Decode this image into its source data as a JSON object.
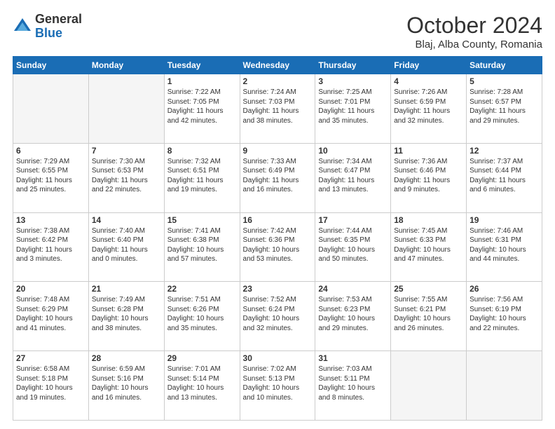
{
  "header": {
    "logo_general": "General",
    "logo_blue": "Blue",
    "month_title": "October 2024",
    "location": "Blaj, Alba County, Romania"
  },
  "weekdays": [
    "Sunday",
    "Monday",
    "Tuesday",
    "Wednesday",
    "Thursday",
    "Friday",
    "Saturday"
  ],
  "weeks": [
    [
      {
        "day": "",
        "info": ""
      },
      {
        "day": "",
        "info": ""
      },
      {
        "day": "1",
        "info": "Sunrise: 7:22 AM\nSunset: 7:05 PM\nDaylight: 11 hours and 42 minutes."
      },
      {
        "day": "2",
        "info": "Sunrise: 7:24 AM\nSunset: 7:03 PM\nDaylight: 11 hours and 38 minutes."
      },
      {
        "day": "3",
        "info": "Sunrise: 7:25 AM\nSunset: 7:01 PM\nDaylight: 11 hours and 35 minutes."
      },
      {
        "day": "4",
        "info": "Sunrise: 7:26 AM\nSunset: 6:59 PM\nDaylight: 11 hours and 32 minutes."
      },
      {
        "day": "5",
        "info": "Sunrise: 7:28 AM\nSunset: 6:57 PM\nDaylight: 11 hours and 29 minutes."
      }
    ],
    [
      {
        "day": "6",
        "info": "Sunrise: 7:29 AM\nSunset: 6:55 PM\nDaylight: 11 hours and 25 minutes."
      },
      {
        "day": "7",
        "info": "Sunrise: 7:30 AM\nSunset: 6:53 PM\nDaylight: 11 hours and 22 minutes."
      },
      {
        "day": "8",
        "info": "Sunrise: 7:32 AM\nSunset: 6:51 PM\nDaylight: 11 hours and 19 minutes."
      },
      {
        "day": "9",
        "info": "Sunrise: 7:33 AM\nSunset: 6:49 PM\nDaylight: 11 hours and 16 minutes."
      },
      {
        "day": "10",
        "info": "Sunrise: 7:34 AM\nSunset: 6:47 PM\nDaylight: 11 hours and 13 minutes."
      },
      {
        "day": "11",
        "info": "Sunrise: 7:36 AM\nSunset: 6:46 PM\nDaylight: 11 hours and 9 minutes."
      },
      {
        "day": "12",
        "info": "Sunrise: 7:37 AM\nSunset: 6:44 PM\nDaylight: 11 hours and 6 minutes."
      }
    ],
    [
      {
        "day": "13",
        "info": "Sunrise: 7:38 AM\nSunset: 6:42 PM\nDaylight: 11 hours and 3 minutes."
      },
      {
        "day": "14",
        "info": "Sunrise: 7:40 AM\nSunset: 6:40 PM\nDaylight: 11 hours and 0 minutes."
      },
      {
        "day": "15",
        "info": "Sunrise: 7:41 AM\nSunset: 6:38 PM\nDaylight: 10 hours and 57 minutes."
      },
      {
        "day": "16",
        "info": "Sunrise: 7:42 AM\nSunset: 6:36 PM\nDaylight: 10 hours and 53 minutes."
      },
      {
        "day": "17",
        "info": "Sunrise: 7:44 AM\nSunset: 6:35 PM\nDaylight: 10 hours and 50 minutes."
      },
      {
        "day": "18",
        "info": "Sunrise: 7:45 AM\nSunset: 6:33 PM\nDaylight: 10 hours and 47 minutes."
      },
      {
        "day": "19",
        "info": "Sunrise: 7:46 AM\nSunset: 6:31 PM\nDaylight: 10 hours and 44 minutes."
      }
    ],
    [
      {
        "day": "20",
        "info": "Sunrise: 7:48 AM\nSunset: 6:29 PM\nDaylight: 10 hours and 41 minutes."
      },
      {
        "day": "21",
        "info": "Sunrise: 7:49 AM\nSunset: 6:28 PM\nDaylight: 10 hours and 38 minutes."
      },
      {
        "day": "22",
        "info": "Sunrise: 7:51 AM\nSunset: 6:26 PM\nDaylight: 10 hours and 35 minutes."
      },
      {
        "day": "23",
        "info": "Sunrise: 7:52 AM\nSunset: 6:24 PM\nDaylight: 10 hours and 32 minutes."
      },
      {
        "day": "24",
        "info": "Sunrise: 7:53 AM\nSunset: 6:23 PM\nDaylight: 10 hours and 29 minutes."
      },
      {
        "day": "25",
        "info": "Sunrise: 7:55 AM\nSunset: 6:21 PM\nDaylight: 10 hours and 26 minutes."
      },
      {
        "day": "26",
        "info": "Sunrise: 7:56 AM\nSunset: 6:19 PM\nDaylight: 10 hours and 22 minutes."
      }
    ],
    [
      {
        "day": "27",
        "info": "Sunrise: 6:58 AM\nSunset: 5:18 PM\nDaylight: 10 hours and 19 minutes."
      },
      {
        "day": "28",
        "info": "Sunrise: 6:59 AM\nSunset: 5:16 PM\nDaylight: 10 hours and 16 minutes."
      },
      {
        "day": "29",
        "info": "Sunrise: 7:01 AM\nSunset: 5:14 PM\nDaylight: 10 hours and 13 minutes."
      },
      {
        "day": "30",
        "info": "Sunrise: 7:02 AM\nSunset: 5:13 PM\nDaylight: 10 hours and 10 minutes."
      },
      {
        "day": "31",
        "info": "Sunrise: 7:03 AM\nSunset: 5:11 PM\nDaylight: 10 hours and 8 minutes."
      },
      {
        "day": "",
        "info": ""
      },
      {
        "day": "",
        "info": ""
      }
    ]
  ]
}
